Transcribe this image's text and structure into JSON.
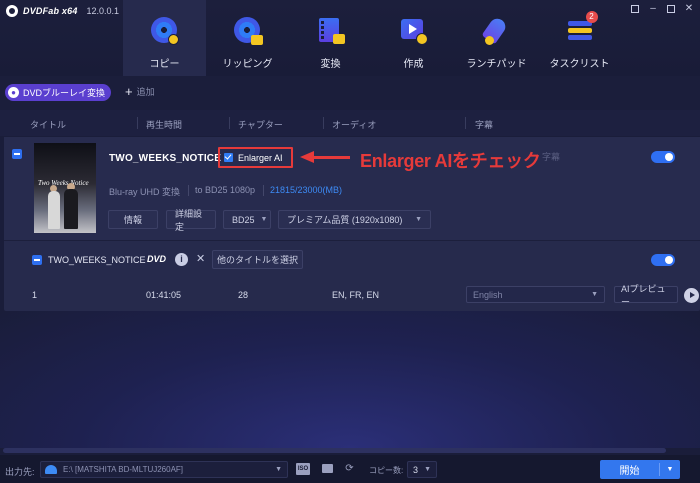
{
  "app": {
    "brand": "DVDFab x64",
    "version": "12.0.0.1"
  },
  "window": {
    "min": "–",
    "close": "✕"
  },
  "nav": {
    "items": [
      {
        "label": "コピー",
        "icon": "disc-copy-icon",
        "active": true
      },
      {
        "label": "リッピング",
        "icon": "disc-ripper-icon",
        "active": false
      },
      {
        "label": "変換",
        "icon": "film-converter-icon",
        "active": false
      },
      {
        "label": "作成",
        "icon": "video-creator-icon",
        "active": false
      },
      {
        "label": "ランチパッド",
        "icon": "rocket-launchpad-icon",
        "active": false
      },
      {
        "label": "タスクリスト",
        "icon": "task-list-icon",
        "active": false,
        "badge": "2"
      }
    ]
  },
  "toolbar": {
    "mode_label": "DVDブルーレイ変換",
    "add_label": "追加"
  },
  "columns": {
    "title": "タイトル",
    "runtime": "再生時間",
    "chapters": "チャプター",
    "audio": "オーディオ",
    "subtitle": "字幕"
  },
  "task": {
    "name": "TWO_WEEKS_NOTICE",
    "enlarger_label": "Enlarger AI",
    "enlarger_checked": true,
    "annotation": "Enlarger AIをチェック",
    "faint_text": "字幕",
    "source_format": "Blu-ray UHD 変換",
    "target_format": "to BD25 1080p",
    "size": "21815/23000(MB)",
    "buttons": {
      "info": "情報",
      "settings": "詳細設定",
      "disc_type": "BD25",
      "quality": "プレミアム品質 (1920x1080)"
    },
    "poster_title": "Two Weeks Notice",
    "title_row": {
      "name": "TWO_WEEKS_NOTICE",
      "dvd_logo": "DVD",
      "info_icon": "i",
      "remove_icon": "✕",
      "select_other": "他のタイトルを選択"
    },
    "track": {
      "number": "1",
      "runtime": "01:41:05",
      "chapters": "28",
      "audio": "EN, FR, EN",
      "subtitle": "English",
      "ai_preview": "AIプレビュー"
    }
  },
  "footer": {
    "output_label": "出力先:",
    "output_path": "E:\\ [MATSHITA BD-MLTUJ260AF]",
    "iso_icon": "ISO",
    "copies_label": "コピー数:",
    "copies_value": "3",
    "start_label": "開始"
  },
  "colors": {
    "accent": "#2f7cf6",
    "annotation": "#e63a3a",
    "mode_pill": "#5a3fcf",
    "background": "#1a1d3a"
  }
}
